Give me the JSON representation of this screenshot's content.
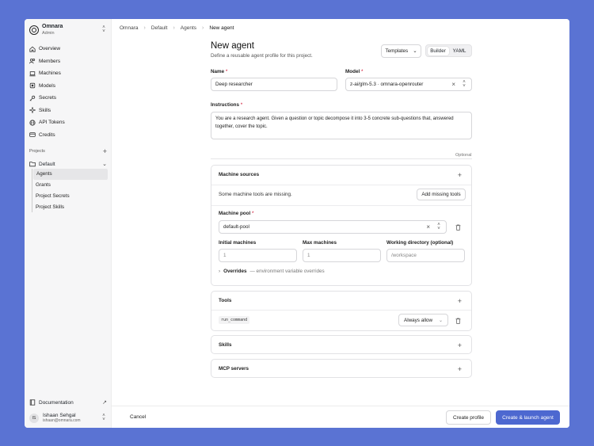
{
  "org": {
    "name": "Omnara",
    "role": "Admin"
  },
  "sidebar": {
    "items": [
      {
        "label": "Overview",
        "icon": "home-icon"
      },
      {
        "label": "Members",
        "icon": "users-icon"
      },
      {
        "label": "Machines",
        "icon": "laptop-icon"
      },
      {
        "label": "Models",
        "icon": "cpu-icon"
      },
      {
        "label": "Secrets",
        "icon": "key-icon"
      },
      {
        "label": "Skills",
        "icon": "sparkle-icon"
      },
      {
        "label": "API Tokens",
        "icon": "globe-icon"
      },
      {
        "label": "Credits",
        "icon": "credit-card-icon"
      }
    ],
    "projects_label": "Projects",
    "project": {
      "name": "Default",
      "items": [
        "Agents",
        "Grants",
        "Project Secrets",
        "Project Skills"
      ],
      "active": "Agents"
    },
    "documentation": "Documentation",
    "user": {
      "initials": "IS",
      "name": "Ishaan Sehgal",
      "email": "ishaan@omnara.com"
    }
  },
  "breadcrumb": [
    "Omnara",
    "Default",
    "Agents",
    "New agent"
  ],
  "page": {
    "title": "New agent",
    "subtitle": "Define a reusable agent profile for this project."
  },
  "toolbar": {
    "templates": "Templates",
    "mode_builder": "Builder",
    "mode_yaml": "YAML",
    "active_mode": "Builder"
  },
  "form": {
    "name_label": "Name",
    "name_value": "Deep researcher",
    "model_label": "Model",
    "model_value": "z-ai/glm-5.3 · omnara-openrouter",
    "instructions_label": "Instructions",
    "instructions_value": "You are a research agent. Given a question or topic decompose it into 3-5 concrete sub-questions that, answered together, cover the topic.",
    "optional_label": "Optional"
  },
  "machine_sources": {
    "title": "Machine sources",
    "warning": "Some machine tools are missing.",
    "add_missing": "Add missing tools",
    "pool_label": "Machine pool",
    "pool_value": "default-pool",
    "initial_label": "Initial machines",
    "initial_placeholder": "1",
    "max_label": "Max machines",
    "max_placeholder": "1",
    "workdir_label": "Working directory (optional)",
    "workdir_placeholder": "/workspace",
    "overrides_label": "Overrides",
    "overrides_desc": "— environment variable overrides"
  },
  "tools": {
    "title": "Tools",
    "tool_name": "run_command",
    "permission": "Always allow"
  },
  "skills": {
    "title": "Skills"
  },
  "mcp": {
    "title": "MCP servers"
  },
  "footer": {
    "cancel": "Cancel",
    "create_profile": "Create profile",
    "create_launch": "Create & launch agent"
  },
  "colors": {
    "background": "#5a73d3",
    "primary": "#4d68d0"
  }
}
